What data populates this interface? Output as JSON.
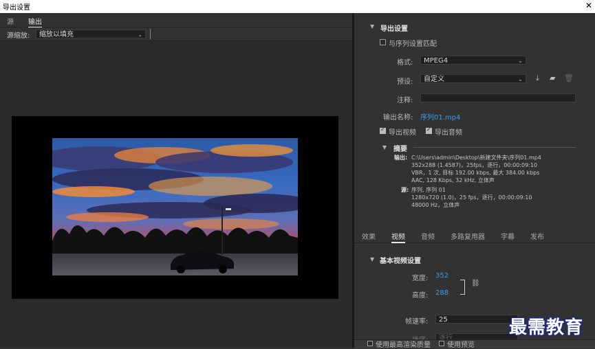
{
  "window": {
    "title": "导出设置",
    "close": "✕"
  },
  "left": {
    "tabs": [
      "源",
      "输出"
    ],
    "scale_label": "源缩放:",
    "scale_value": "缩放以填充"
  },
  "right": {
    "export_settings": {
      "header": "导出设置",
      "match_sequence": "与序列设置匹配",
      "format_label": "格式:",
      "format_value": "MPEG4",
      "preset_label": "预设:",
      "preset_value": "自定义",
      "comments_label": "注释:",
      "comments_value": "",
      "output_name_label": "输出名称:",
      "output_name_value": "序列01.mp4",
      "export_video": "导出视频",
      "export_audio": "导出音频"
    },
    "summary": {
      "header": "摘要",
      "output_label": "输出:",
      "output_lines": [
        "C:\\Users\\admin\\Desktop\\新建文件夹\\序列01.mp4",
        "352x288 (1.4587)，25fps，逐行，00:00:09:10",
        "VBR，1 次, 目标 192.00 kbps, 最大 384.00 kbps",
        "AAC, 128 Kbps, 32  kHz, 立体声"
      ],
      "source_label": "源:",
      "source_lines": [
        "序列, 序列 01",
        "1280x720 (1.0)，25 fps，逐行，00:00:09:10",
        "48000 Hz，立体声"
      ]
    },
    "tabs": [
      "效果",
      "视频",
      "音频",
      "多路复用器",
      "字幕",
      "发布"
    ],
    "basic_video": {
      "header": "基本视频设置",
      "width_label": "宽度:",
      "width_value": "352",
      "height_label": "高度:",
      "height_value": "288",
      "fps_label": "帧速率:",
      "fps_value": "25",
      "field_label": "场序:",
      "field_value": "逐行"
    },
    "bottom": {
      "max_quality": "使用最高渲染质量",
      "use_preview": "使用预览"
    }
  },
  "watermark": "最需教育"
}
